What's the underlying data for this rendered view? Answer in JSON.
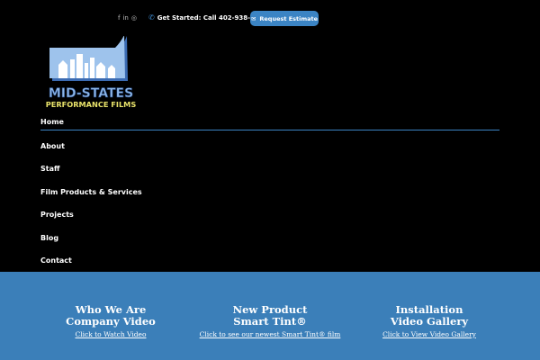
{
  "header": {
    "social": [
      {
        "icon": "facebook-icon",
        "glyph": "f"
      },
      {
        "icon": "linkedin-icon",
        "glyph": "in"
      },
      {
        "icon": "instagram-icon",
        "glyph": "◎"
      }
    ],
    "phone_text": "Get Started: Call 402-938-4275",
    "request_button": "Request Estimate"
  },
  "logo": {
    "line1": "MID-STATES",
    "line2": "PERFORMANCE FILMS"
  },
  "nav": [
    {
      "label": "Home"
    },
    {
      "label": "About"
    },
    {
      "label": "Staff"
    },
    {
      "label": "Film Products & Services"
    },
    {
      "label": "Projects"
    },
    {
      "label": "Blog"
    },
    {
      "label": "Contact"
    }
  ],
  "footer": [
    {
      "line1": "Who We Are",
      "line2": "Company Video",
      "link": "Click to Watch Video"
    },
    {
      "line1": "New Product",
      "line2": "Smart Tint®",
      "link": "Click to see our newest Smart Tint® film"
    },
    {
      "line1": "Installation",
      "line2": "Video Gallery",
      "link": "Click to View Video Gallery"
    }
  ],
  "colors": {
    "accent": "#3b84c4",
    "footer_bg": "#3b7fb9",
    "logo_yellow": "#e9e36a"
  }
}
